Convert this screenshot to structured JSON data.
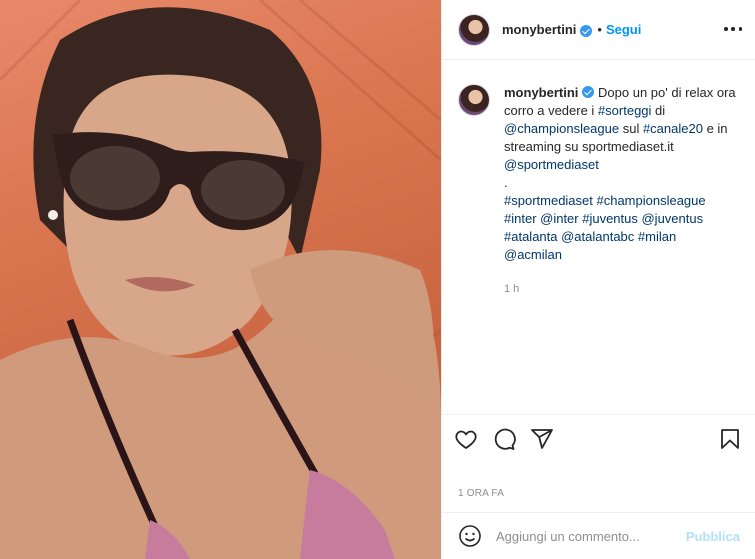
{
  "post": {
    "username": "monybertini",
    "verified": true,
    "separator": "•",
    "follow_label": "Segui",
    "more_icon": "more-horizontal-icon",
    "caption": {
      "line1_text": "Dopo un po' di relax ora corro a vedere i ",
      "line1_tag": "#sorteggi",
      "line1_after": " di",
      "mention1": "@championsleague",
      "text2": " sul ",
      "tag2": "#canale20",
      "text3": " e in streaming su sportmediaset.it",
      "mention2": "@sportmediaset",
      "sep": ".",
      "tags_line1": "#sportmediaset #championsleague",
      "tags_line2": "#inter @inter #juventus @juventus",
      "tags_line3": "#atalanta @atalantabc #milan",
      "tags_line4": "@acmilan"
    },
    "caption_age": "1 h",
    "timestamp": "1 ORA FA",
    "comment_placeholder": "Aggiungi un commento...",
    "publish_label": "Pubblica"
  },
  "colors": {
    "accent": "#0095f6",
    "link": "#00376b",
    "muted": "#8e8e8e",
    "publish_disabled": "#b2dffc"
  }
}
